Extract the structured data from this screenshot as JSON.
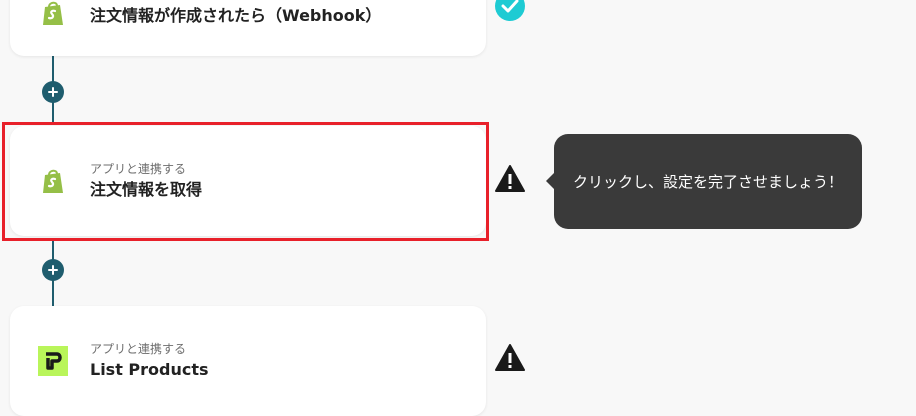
{
  "colors": {
    "connector": "#1f5d6e",
    "selection_outline": "#e8202a",
    "success": "#1ecbd3",
    "warning": "#1a1a1a",
    "shopify_green": "#95bf47",
    "tooltip_bg": "#3a3a3a"
  },
  "flow": {
    "steps": [
      {
        "title": "注文情報が作成されたら（Webhook）",
        "icon": "shopify-icon",
        "status": "completed"
      },
      {
        "subtitle": "アプリと連携する",
        "title": "注文情報を取得",
        "icon": "shopify-icon",
        "status": "warning",
        "selected": true
      },
      {
        "subtitle": "アプリと連携する",
        "title": "List Products",
        "icon": "app-logo-p-icon",
        "status": "warning"
      }
    ]
  },
  "tooltip": {
    "text": "クリックし、設定を完了させましょう！"
  }
}
